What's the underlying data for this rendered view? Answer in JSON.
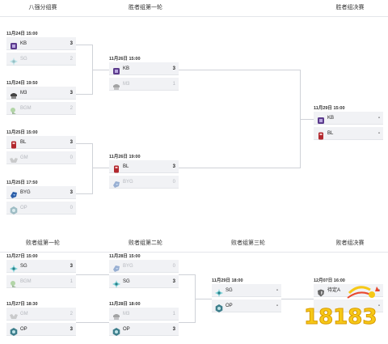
{
  "headers": {
    "top": [
      "八强分组赛",
      "胜者组第一轮",
      "胜者组决赛"
    ],
    "bottom": [
      "败者组第一轮",
      "败者组第二轮",
      "败者组第三轮",
      "败者组决赛"
    ]
  },
  "matches": {
    "qf1": {
      "date": "11月24日 15:00",
      "teams": [
        {
          "name": "KB",
          "score": "3",
          "icon": "kb-logo-icon"
        },
        {
          "name": "SG",
          "score": "2",
          "icon": "sg-logo-icon"
        }
      ]
    },
    "qf2": {
      "date": "11月24日 19:50",
      "teams": [
        {
          "name": "M3",
          "score": "3",
          "icon": "m3-logo-icon"
        },
        {
          "name": "BGM",
          "score": "2",
          "icon": "bgm-logo-icon"
        }
      ]
    },
    "qf3": {
      "date": "11月25日 15:00",
      "teams": [
        {
          "name": "BL",
          "score": "3",
          "icon": "bl-logo-icon"
        },
        {
          "name": "GM",
          "score": "0",
          "icon": "gm-logo-icon"
        }
      ]
    },
    "qf4": {
      "date": "11月25日 17:50",
      "teams": [
        {
          "name": "BYG",
          "score": "3",
          "icon": "byg-logo-icon"
        },
        {
          "name": "OP",
          "score": "0",
          "icon": "op-logo-icon"
        }
      ]
    },
    "wr1a": {
      "date": "11月26日 15:00",
      "teams": [
        {
          "name": "KB",
          "score": "3",
          "icon": "kb-logo-icon"
        },
        {
          "name": "M3",
          "score": "1",
          "icon": "m3-logo-icon"
        }
      ]
    },
    "wr1b": {
      "date": "11月26日 19:00",
      "teams": [
        {
          "name": "BL",
          "score": "3",
          "icon": "bl-logo-icon"
        },
        {
          "name": "BYG",
          "score": "0",
          "icon": "byg-logo-icon"
        }
      ]
    },
    "wf": {
      "date": "11月29日 15:00",
      "teams": [
        {
          "name": "KB",
          "score": "-",
          "icon": "kb-logo-icon"
        },
        {
          "name": "BL",
          "score": "-",
          "icon": "bl-logo-icon"
        }
      ]
    },
    "lr1a": {
      "date": "11月27日 15:00",
      "teams": [
        {
          "name": "SG",
          "score": "3",
          "icon": "sg-logo-icon"
        },
        {
          "name": "BGM",
          "score": "1",
          "icon": "bgm-logo-icon"
        }
      ]
    },
    "lr1b": {
      "date": "11月27日 18:30",
      "teams": [
        {
          "name": "GM",
          "score": "2",
          "icon": "gm-logo-icon"
        },
        {
          "name": "OP",
          "score": "3",
          "icon": "op-logo-icon"
        }
      ]
    },
    "lr2a": {
      "date": "11月28日 15:00",
      "teams": [
        {
          "name": "BYG",
          "score": "0",
          "icon": "byg-logo-icon"
        },
        {
          "name": "SG",
          "score": "3",
          "icon": "sg-logo-icon"
        }
      ]
    },
    "lr2b": {
      "date": "11月28日 18:00",
      "teams": [
        {
          "name": "M3",
          "score": "1",
          "icon": "m3-logo-icon"
        },
        {
          "name": "OP",
          "score": "3",
          "icon": "op-logo-icon"
        }
      ]
    },
    "lr3": {
      "date": "11月29日 18:00",
      "teams": [
        {
          "name": "SG",
          "score": "-",
          "icon": "sg-logo-icon"
        },
        {
          "name": "OP",
          "score": "-",
          "icon": "op-logo-icon"
        }
      ]
    },
    "lf": {
      "date": "12月07日 16:00",
      "teams": [
        {
          "name": "待定A",
          "score": "-",
          "icon": "shield-icon"
        },
        {
          "name": "",
          "score": "-",
          "icon": ""
        }
      ]
    }
  },
  "watermark": {
    "text": "18183"
  },
  "colors": {
    "KB": "#5b3a8c",
    "SG": "#7fd3d8",
    "M3": "#444444",
    "BGM": "#67b34a",
    "BL": "#b2282e",
    "GM": "#9a9a9a",
    "BYG": "#2d5fa8",
    "OP": "#3e7f8c",
    "panel": "#f1f2f5",
    "line": "#cfd2d8",
    "watermark_main": "#f6c817",
    "watermark_accent": "#e8492f"
  }
}
